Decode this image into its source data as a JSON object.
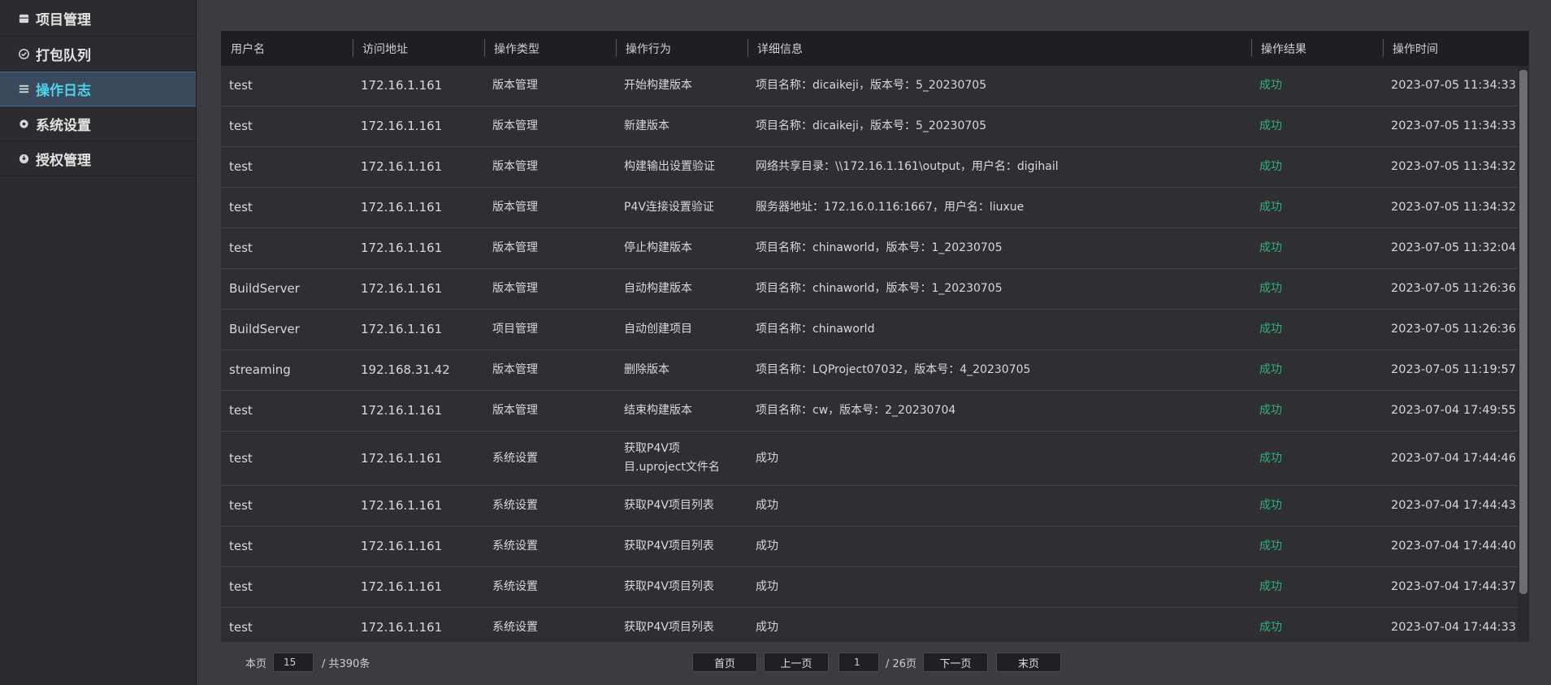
{
  "sidebar": {
    "items": [
      {
        "label": "项目管理",
        "icon": "project-icon"
      },
      {
        "label": "打包队列",
        "icon": "queue-icon"
      },
      {
        "label": "操作日志",
        "icon": "log-icon",
        "active": true
      },
      {
        "label": "系统设置",
        "icon": "gear-icon"
      },
      {
        "label": "授权管理",
        "icon": "license-icon"
      }
    ]
  },
  "table": {
    "headers": [
      "用户名",
      "访问地址",
      "操作类型",
      "操作行为",
      "详细信息",
      "操作结果",
      "操作时间"
    ],
    "rows": [
      [
        "test",
        "172.16.1.161",
        "版本管理",
        "开始构建版本",
        "项目名称：dicaikeji，版本号：5_20230705",
        "成功",
        "2023-07-05 11:34:33"
      ],
      [
        "test",
        "172.16.1.161",
        "版本管理",
        "新建版本",
        "项目名称：dicaikeji，版本号：5_20230705",
        "成功",
        "2023-07-05 11:34:33"
      ],
      [
        "test",
        "172.16.1.161",
        "版本管理",
        "构建输出设置验证",
        "网络共享目录：\\\\172.16.1.161\\output，用户名：digihail",
        "成功",
        "2023-07-05 11:34:32"
      ],
      [
        "test",
        "172.16.1.161",
        "版本管理",
        "P4V连接设置验证",
        "服务器地址：172.16.0.116:1667，用户名：liuxue",
        "成功",
        "2023-07-05 11:34:32"
      ],
      [
        "test",
        "172.16.1.161",
        "版本管理",
        "停止构建版本",
        "项目名称：chinaworld，版本号：1_20230705",
        "成功",
        "2023-07-05 11:32:04"
      ],
      [
        "BuildServer",
        "172.16.1.161",
        "版本管理",
        "自动构建版本",
        "项目名称：chinaworld，版本号：1_20230705",
        "成功",
        "2023-07-05 11:26:36"
      ],
      [
        "BuildServer",
        "172.16.1.161",
        "项目管理",
        "自动创建项目",
        "项目名称：chinaworld",
        "成功",
        "2023-07-05 11:26:36"
      ],
      [
        "streaming",
        "192.168.31.42",
        "版本管理",
        "删除版本",
        "项目名称：LQProject07032，版本号：4_20230705",
        "成功",
        "2023-07-05 11:19:57"
      ],
      [
        "test",
        "172.16.1.161",
        "版本管理",
        "结束构建版本",
        "项目名称：cw，版本号：2_20230704",
        "成功",
        "2023-07-04 17:49:55"
      ],
      [
        "test",
        "172.16.1.161",
        "系统设置",
        "获取P4V项目.uproject文件名",
        "成功",
        "成功",
        "2023-07-04 17:44:46"
      ],
      [
        "test",
        "172.16.1.161",
        "系统设置",
        "获取P4V项目列表",
        "成功",
        "成功",
        "2023-07-04 17:44:43"
      ],
      [
        "test",
        "172.16.1.161",
        "系统设置",
        "获取P4V项目列表",
        "成功",
        "成功",
        "2023-07-04 17:44:40"
      ],
      [
        "test",
        "172.16.1.161",
        "系统设置",
        "获取P4V项目列表",
        "成功",
        "成功",
        "2023-07-04 17:44:37"
      ],
      [
        "test",
        "172.16.1.161",
        "系统设置",
        "获取P4V项目列表",
        "成功",
        "成功",
        "2023-07-04 17:44:33"
      ]
    ]
  },
  "pager": {
    "per_page_label": "本页",
    "per_page_value": "15",
    "total_label": "/ 共390条",
    "first": "首页",
    "prev": "上一页",
    "current_page": "1",
    "total_pages": "/ 26页",
    "next": "下一页",
    "last": "末页"
  },
  "colors": {
    "accent": "#4fd2ea",
    "success": "#2fb07a"
  }
}
